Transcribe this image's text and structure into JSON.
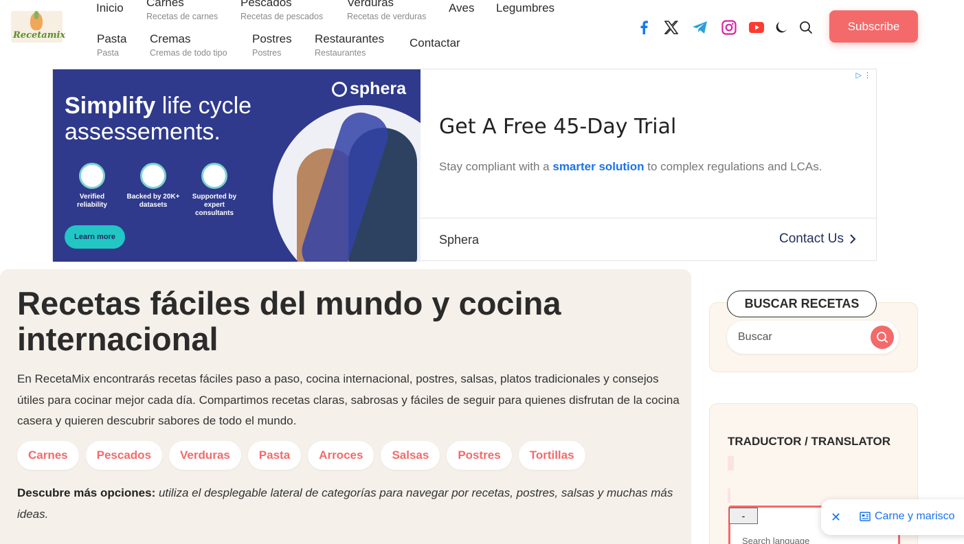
{
  "header": {
    "logo_text": "Recetamix",
    "nav": [
      {
        "label": "Inicio",
        "sub": ""
      },
      {
        "label": "Carnes",
        "sub": "Recetas de carnes"
      },
      {
        "label": "Pescados",
        "sub": "Recetas de pescados"
      },
      {
        "label": "Verduras",
        "sub": "Recetas de verduras"
      },
      {
        "label": "Aves",
        "sub": ""
      },
      {
        "label": "Legumbres",
        "sub": ""
      },
      {
        "label": "Pasta",
        "sub": "Pasta"
      },
      {
        "label": "Cremas",
        "sub": "Cremas de todo tipo"
      },
      {
        "label": "Postres",
        "sub": "Postres"
      },
      {
        "label": "Restaurantes",
        "sub": "Restaurantes"
      },
      {
        "label": "Contactar",
        "sub": ""
      }
    ],
    "social_icons": [
      "facebook-icon",
      "x-icon",
      "telegram-icon",
      "instagram-icon",
      "youtube-icon",
      "moon-icon",
      "search-icon"
    ],
    "subscribe_label": "Subscribe",
    "colors": {
      "accent": "#f46a6a",
      "facebook": "#1877f2",
      "telegram": "#2aa1da",
      "instagram": "#d6249f",
      "youtube": "#ff3b30"
    }
  },
  "ad": {
    "brand_logo": "sphera",
    "banner_headline_bold": "Simplify",
    "banner_headline_rest": " life cycle assessements.",
    "features": [
      "Verified reliability",
      "Backed by 20K+ datasets",
      "Supported by expert consultants"
    ],
    "learn_more": "Learn more",
    "title": "Get A Free 45-Day Trial",
    "desc_before": "Stay compliant with a ",
    "desc_highlight": "smarter solution",
    "desc_after": " to complex regulations and LCAs.",
    "advertiser": "Sphera",
    "cta": "Contact Us"
  },
  "main": {
    "title": "Recetas fáciles del mundo y cocina internacional",
    "intro": "En RecetaMix encontrarás recetas fáciles paso a paso, cocina internacional, postres, salsas, platos tradicionales y consejos útiles para cocinar mejor cada día. Compartimos recetas claras, sabrosas y fáciles de seguir para quienes disfrutan de la cocina casera y quieren descubrir sabores de todo el mundo.",
    "chips": [
      "Carnes",
      "Pescados",
      "Verduras",
      "Pasta",
      "Arroces",
      "Salsas",
      "Postres",
      "Tortillas"
    ],
    "more_bold": "Descubre más opciones:",
    "more_italic": " utiliza el desplegable lateral de categorías para navegar por recetas, postres, salsas y muchas más ideas."
  },
  "sidebar": {
    "search_title": "BUSCAR RECETAS",
    "search_placeholder": "Buscar",
    "translator_title": "TRADUCTOR / TRANSLATOR",
    "minus_label": "-",
    "lang_search": "Search language"
  },
  "toast": {
    "label": "Carne y marisco"
  }
}
